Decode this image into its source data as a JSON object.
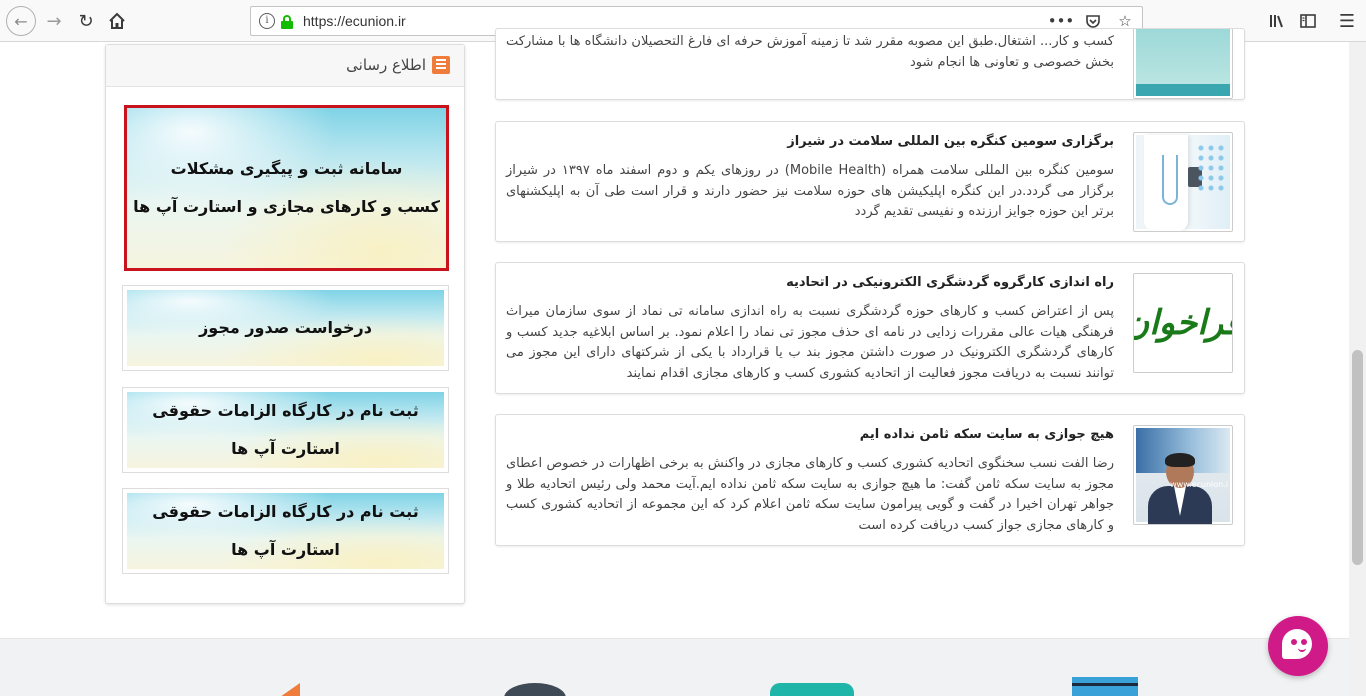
{
  "browser": {
    "url": "https://ecunion.ir"
  },
  "sidebar": {
    "title": "اطلاع رسانی",
    "banners": [
      {
        "line1": "سامانه ثبت و پیگیری مشکلات",
        "line2": "کسب و کارهای مجازی و استارت آپ ها"
      },
      {
        "line1": "درخواست صدور مجوز",
        "line2": ""
      },
      {
        "line1": "ثبت نام در کارگاه الزامات حقوقی استارت آپ ها",
        "line2": ""
      },
      {
        "line1": "ثبت نام در کارگاه الزامات حقوقی استارت آپ ها",
        "line2": ""
      }
    ]
  },
  "news": [
    {
      "title": "",
      "body": "کسب و کار... اشتغال.طبق این مصوبه مقرر شد تا زمینه آموزش حرفه ای فارغ التحصیلان دانشگاه ها با مشارکت بخش خصوصی و تعاونی ها انجام شود"
    },
    {
      "title": "برگزاری سومین کنگره بین المللی سلامت در شیراز",
      "body": "سومین کنگره بین المللی سلامت همراه (Mobile Health) در روزهای یکم و دوم اسفند ماه ۱۳۹۷ در شیراز برگزار می گردد.در این کنگره اپلیکیشن های حوزه سلامت نیز حضور دارند و قرار است طی آن به اپلیکشنهای برتر این حوزه جوایز ارزنده و نفیسی تقدیم گردد"
    },
    {
      "title": "راه اندازی کارگروه گردشگری الکترونیکی در اتحادیه",
      "body": "پس از اعتراض کسب و کارهای حوزه گردشگری نسبت به راه اندازی سامانه تی نماد از سوی سازمان میراث فرهنگی هیات عالی مقررات زدایی در نامه ای حذف مجوز تی نماد را اعلام نمود. بر اساس ابلاغیه جدید کسب و کارهای گردشگری الکترونیک در صورت داشتن مجوز بند ب یا قرارداد با یکی از شرکتهای دارای این مجوز می توانند نسبت به دریافت مجوز فعالیت از اتحادیه کشوری کسب و کارهای مجازی اقدام نمایند",
      "thumb_text": "فراخوان"
    },
    {
      "title": "هیچ جوازی به سایت سکه ثامن نداده ایم",
      "body": "رضا الفت نسب سخنگوی اتحادیه کشوری کسب و کارهای مجازی در واکنش به برخی اظهارات در خصوص اعطای مجوز به سایت سکه ثامن گفت: ما هیچ جوازی به سایت سکه ثامن نداده ایم.آیت محمد ولی رئیس اتحادیه طلا و جواهر تهران اخیرا در گفت و گویی پیرامون سایت سکه ثامن اعلام کرد که این مجموعه از اتحادیه کشوری کسب و کارهای مجازی جواز کسب دریافت کرده است",
      "thumb_text": "www.ecunion.i"
    }
  ],
  "colors": {
    "accent_red": "#c8121c",
    "chat": "#d01a88",
    "lock_green": "#12bc00"
  }
}
